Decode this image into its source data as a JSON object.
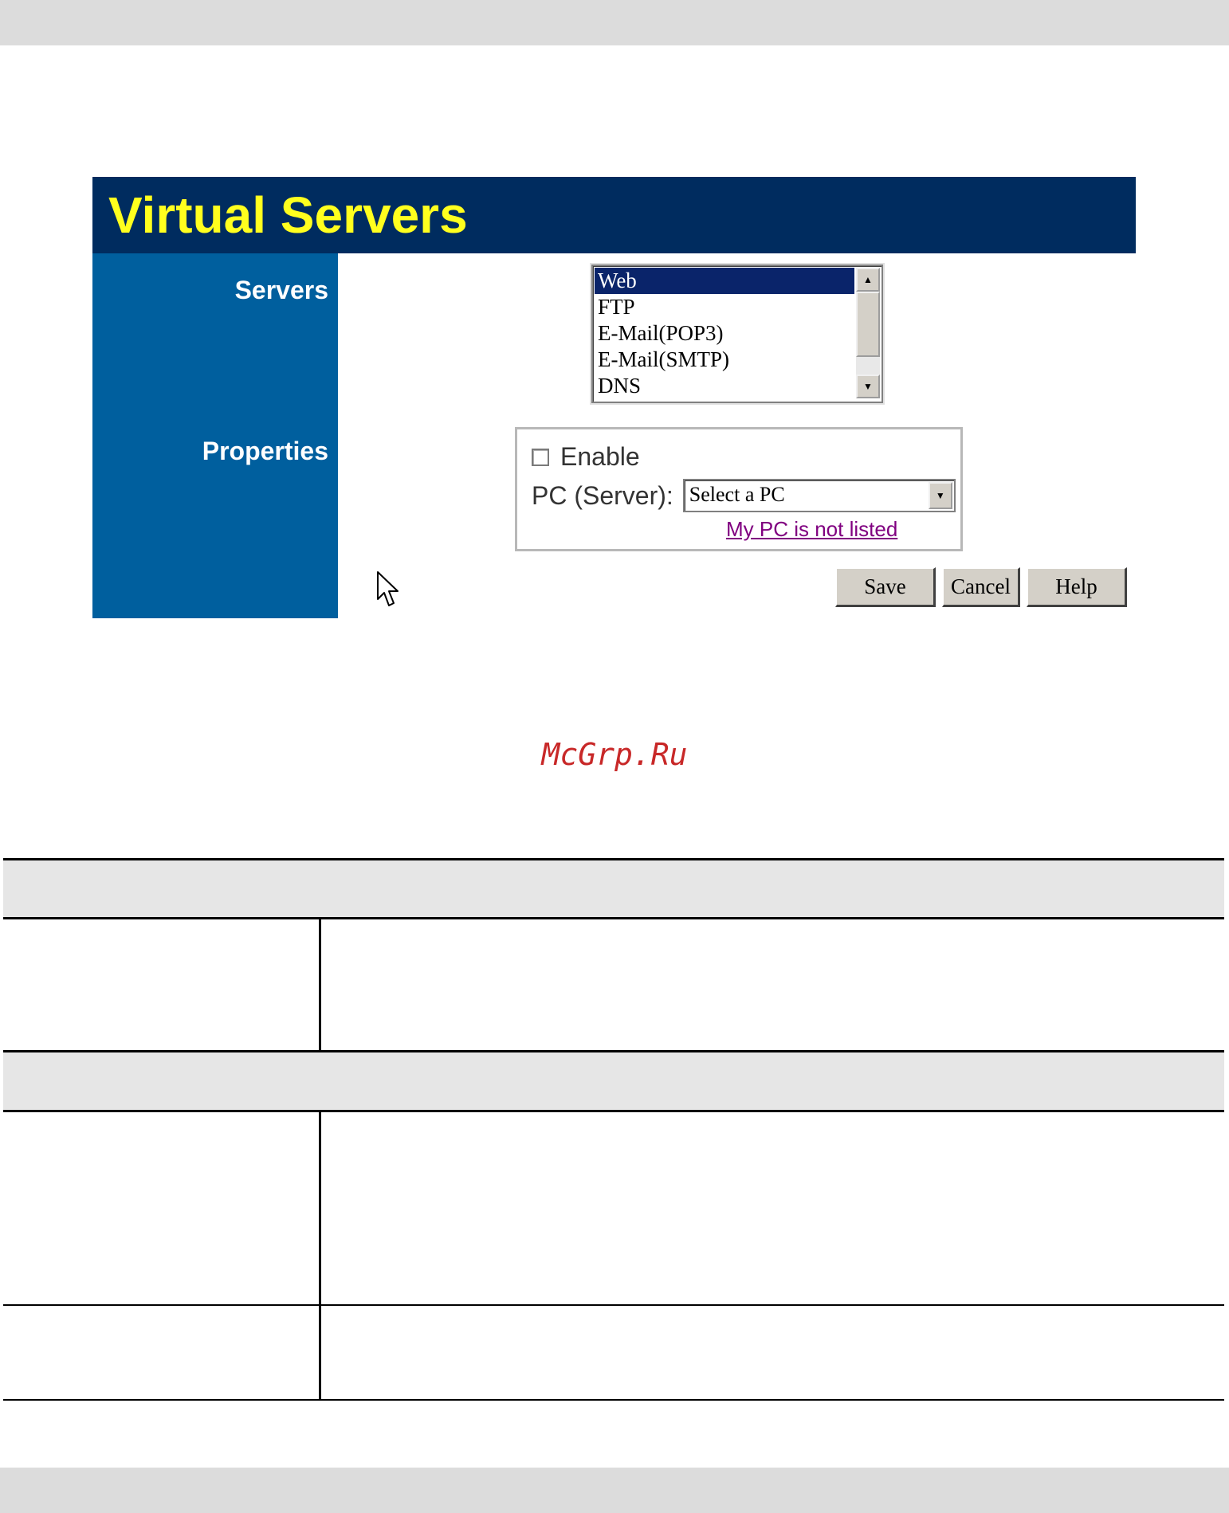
{
  "ui": {
    "title": "Virtual Servers",
    "sidebar": {
      "servers_label": "Servers",
      "properties_label": "Properties"
    },
    "servers_list": {
      "items": [
        "Web",
        "FTP",
        "E-Mail(POP3)",
        "E-Mail(SMTP)",
        "DNS"
      ],
      "selected": "Web"
    },
    "properties": {
      "enable_label": "Enable",
      "enable_checked": false,
      "pc_server_label": "PC (Server):",
      "pc_select_value": "Select a PC",
      "not_listed_link": "My PC is not listed"
    },
    "buttons": {
      "save": "Save",
      "cancel": "Cancel",
      "help": "Help"
    }
  },
  "watermark": "McGrp.Ru",
  "colors": {
    "title_bar": "#002c5f",
    "title_text": "#ffff1e",
    "sidebar": "#005f9e",
    "selection": "#0a246a",
    "link_visited": "#800080",
    "watermark": "#c82828"
  }
}
